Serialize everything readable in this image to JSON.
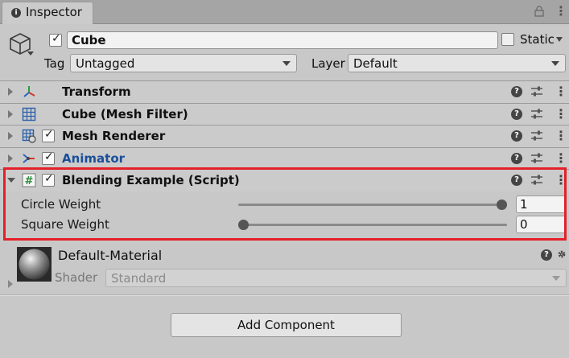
{
  "tab": {
    "title": "Inspector"
  },
  "gameobject": {
    "active": true,
    "name": "Cube",
    "static_label": "Static",
    "static_checked": false,
    "tag_label": "Tag",
    "tag_value": "Untagged",
    "layer_label": "Layer",
    "layer_value": "Default"
  },
  "components": [
    {
      "title": "Transform",
      "icon": "transform-icon",
      "has_checkbox": false,
      "expanded": false
    },
    {
      "title": "Cube (Mesh Filter)",
      "icon": "mesh-filter-icon",
      "has_checkbox": false,
      "expanded": false
    },
    {
      "title": "Mesh Renderer",
      "icon": "mesh-renderer-icon",
      "has_checkbox": true,
      "checked": true,
      "expanded": false
    },
    {
      "title": "Animator",
      "icon": "animator-icon",
      "has_checkbox": true,
      "checked": true,
      "expanded": false,
      "color": "#1a4f9a"
    },
    {
      "title": "Blending Example (Script)",
      "icon": "script-icon",
      "has_checkbox": true,
      "checked": true,
      "expanded": true
    }
  ],
  "script_props": [
    {
      "label": "Circle Weight",
      "value": "1",
      "slider_fraction": 1.0
    },
    {
      "label": "Square Weight",
      "value": "0",
      "slider_fraction": 0.0
    }
  ],
  "material": {
    "name": "Default-Material",
    "shader_label": "Shader",
    "shader_value": "Standard"
  },
  "add_component_label": "Add Component",
  "colors": {
    "highlight": "#e4202a",
    "animator_title": "#1a4f9a",
    "script_icon": "#2f8a3c"
  }
}
